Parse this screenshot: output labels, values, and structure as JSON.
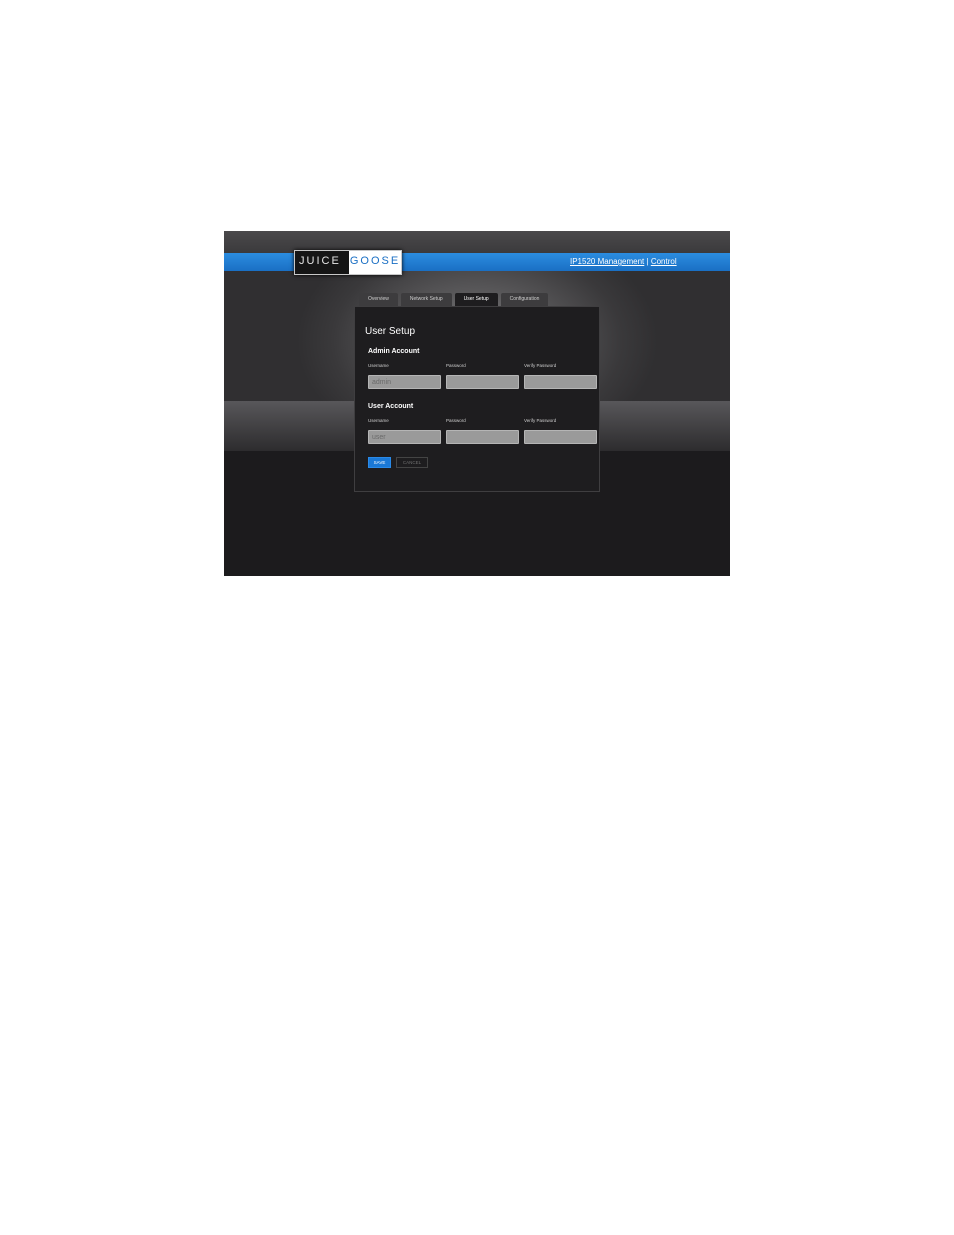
{
  "header": {
    "logo_left": "JUICE",
    "logo_right": "GOOSE",
    "link_management": "IP1520 Management",
    "link_separator": " | ",
    "link_control": "Control"
  },
  "tabs": [
    {
      "label": "Overview",
      "active": false
    },
    {
      "label": "Network Setup",
      "active": false
    },
    {
      "label": "User Setup",
      "active": true
    },
    {
      "label": "Configuration",
      "active": false
    }
  ],
  "panel": {
    "title": "User Setup",
    "admin": {
      "heading": "Admin Account",
      "username_label": "Username",
      "password_label": "Password",
      "verify_label": "Verify Password",
      "username_value": "admin",
      "password_value": "",
      "verify_value": ""
    },
    "user": {
      "heading": "User Account",
      "username_label": "Username",
      "password_label": "Password",
      "verify_label": "Verify Password",
      "username_value": "user",
      "password_value": "",
      "verify_value": ""
    },
    "save_label": "SAVE",
    "cancel_label": "CANCEL"
  },
  "colors": {
    "accent_blue": "#1a78d6",
    "background": "#1c1b1d"
  }
}
